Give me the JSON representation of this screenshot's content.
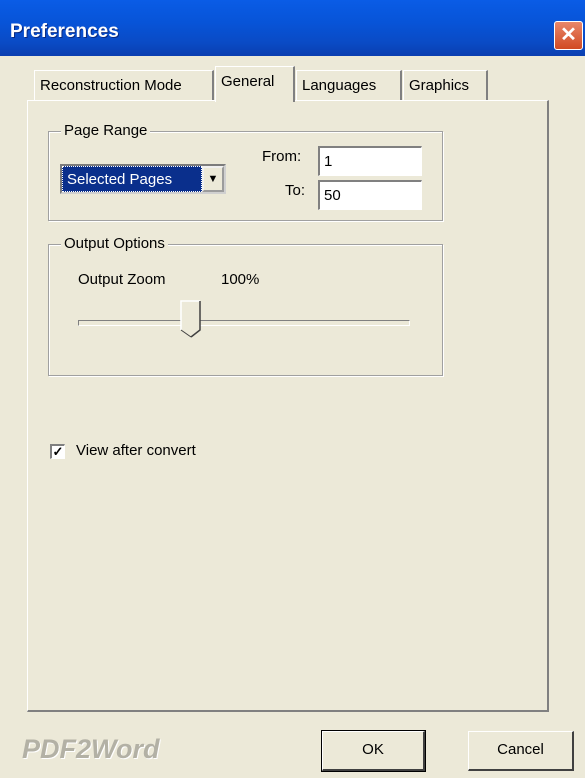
{
  "window": {
    "title": "Preferences"
  },
  "tabs": [
    {
      "label": "Reconstruction Mode"
    },
    {
      "label": "General"
    },
    {
      "label": "Languages"
    },
    {
      "label": "Graphics"
    }
  ],
  "page_range": {
    "legend": "Page Range",
    "select_value": "Selected Pages",
    "from_label": "From:",
    "from_value": "1",
    "to_label": "To:",
    "to_value": "50"
  },
  "output_options": {
    "legend": "Output Options",
    "zoom_label": "Output Zoom",
    "zoom_value": "100%"
  },
  "view_after_convert": {
    "label": "View after convert",
    "checked": true
  },
  "footer": {
    "brand": "PDF2Word",
    "ok_label": "OK",
    "cancel_label": "Cancel"
  }
}
